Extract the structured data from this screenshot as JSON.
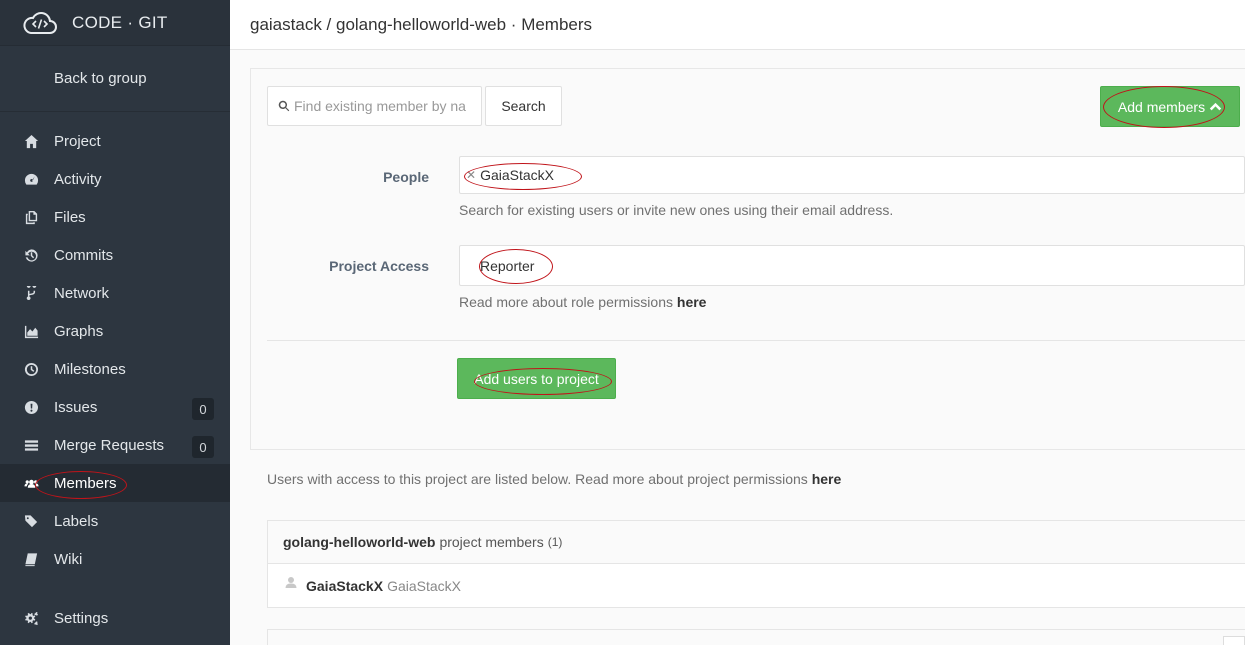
{
  "brand": {
    "title": "CODE · GIT"
  },
  "sidebar": {
    "back_label": "Back to group",
    "items": [
      {
        "label": "Project",
        "icon": "home-icon"
      },
      {
        "label": "Activity",
        "icon": "dashboard-icon"
      },
      {
        "label": "Files",
        "icon": "files-icon"
      },
      {
        "label": "Commits",
        "icon": "history-icon"
      },
      {
        "label": "Network",
        "icon": "branch-icon"
      },
      {
        "label": "Graphs",
        "icon": "area-chart-icon"
      },
      {
        "label": "Milestones",
        "icon": "clock-icon"
      },
      {
        "label": "Issues",
        "icon": "exclamation-icon",
        "count": "0"
      },
      {
        "label": "Merge Requests",
        "icon": "list-icon",
        "count": "0"
      },
      {
        "label": "Members",
        "icon": "users-icon",
        "active": true
      },
      {
        "label": "Labels",
        "icon": "tags-icon"
      },
      {
        "label": "Wiki",
        "icon": "book-icon"
      },
      {
        "label": "Settings",
        "icon": "cogs-icon"
      }
    ]
  },
  "header": {
    "breadcrumb": "gaiastack / golang-helloworld-web · Members"
  },
  "search": {
    "placeholder": "Find existing member by na",
    "button_label": "Search"
  },
  "add_members_label": "Add members",
  "form": {
    "people_label": "People",
    "people_token": "GaiaStackX",
    "people_help": "Search for existing users or invite new ones using their email address.",
    "access_label": "Project Access",
    "access_value": "Reporter",
    "access_help": "Read more about role permissions",
    "access_help_link": "here",
    "submit_label": "Add users to project"
  },
  "info": {
    "text": "Users with access to this project are listed below. Read more about project permissions",
    "link": "here"
  },
  "members": {
    "project_name": "golang-helloworld-web",
    "heading_suffix": "project members",
    "count": "(1)",
    "rows": [
      {
        "name": "GaiaStackX",
        "username": "GaiaStackX"
      }
    ]
  },
  "colors": {
    "sidebar_bg": "#2d3640",
    "accent_green": "#5cb85c",
    "annotation_red": "#c0141a"
  }
}
